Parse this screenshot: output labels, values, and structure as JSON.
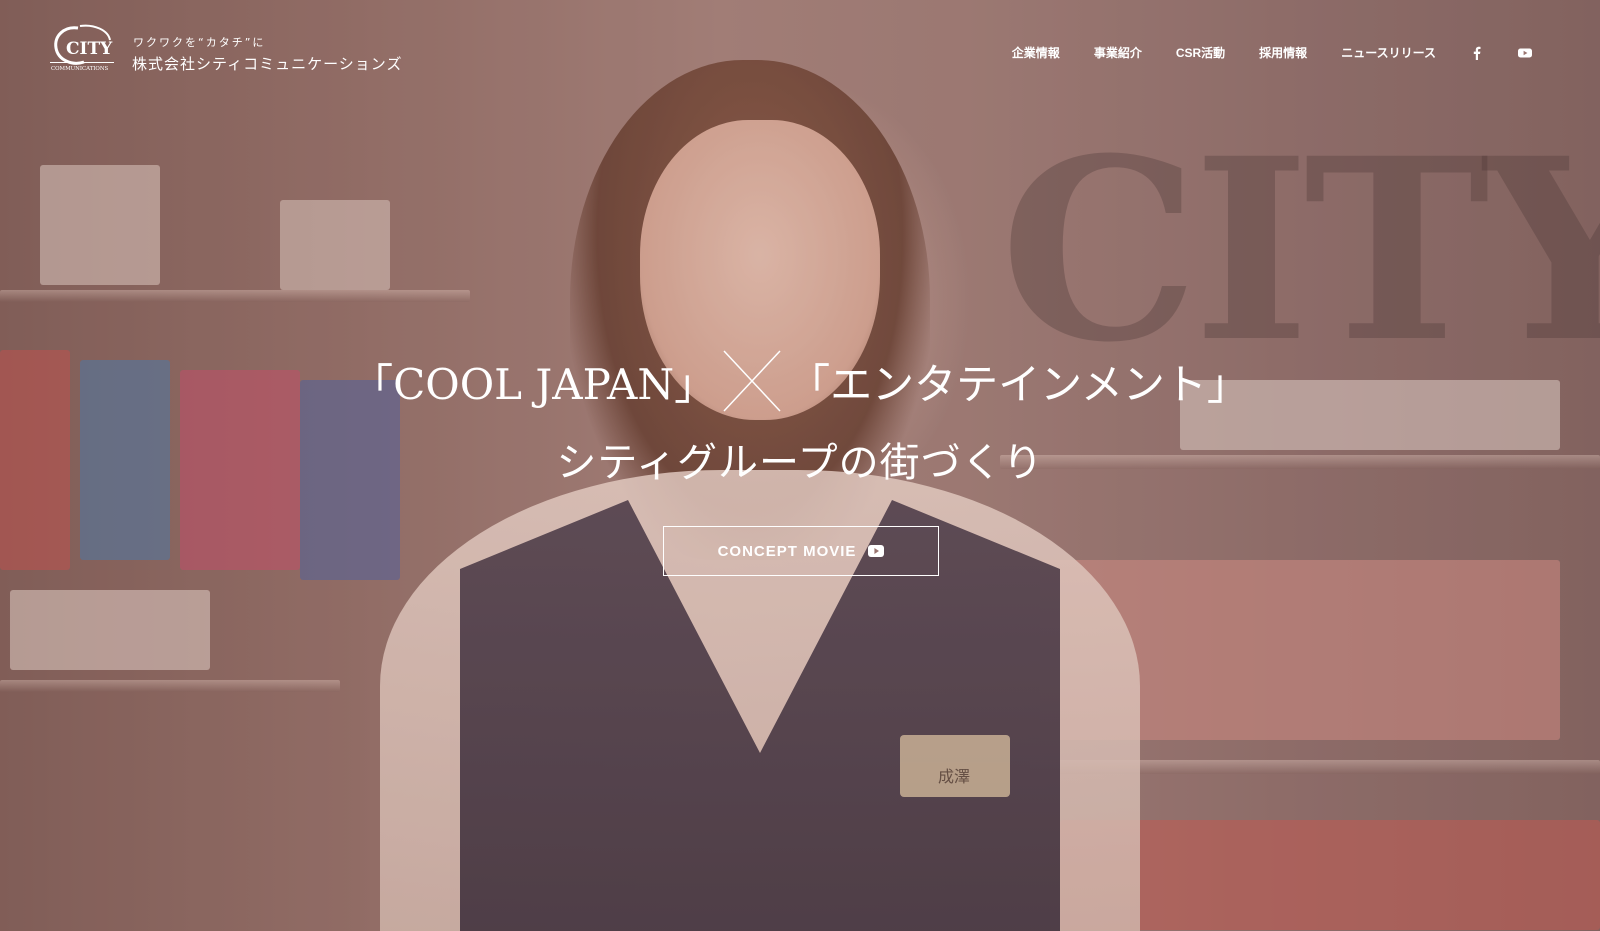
{
  "header": {
    "logo_text": "CITY",
    "logo_subtext": "COMMUNICATIONS",
    "tagline": "ワクワクを“カタチ”に",
    "company_name": "株式会社シティコミュニケーションズ"
  },
  "nav": {
    "items": [
      {
        "label": "企業情報"
      },
      {
        "label": "事業紹介"
      },
      {
        "label": "CSR活動"
      },
      {
        "label": "採用情報"
      },
      {
        "label": "ニュースリリース"
      }
    ],
    "social": [
      "facebook-icon",
      "youtube-icon"
    ]
  },
  "hero": {
    "catch_left": "「COOL JAPAN」",
    "catch_right": "「エンタテインメント」",
    "catch_line2": "シティグループの街づくり",
    "button_label": "CONCEPT MOVIE",
    "button_icon": "youtube-icon",
    "photo_sign": "CITY",
    "name_tag": "成澤"
  },
  "colors": {
    "text": "#ffffff",
    "overlay_tint": "#a06e64"
  }
}
